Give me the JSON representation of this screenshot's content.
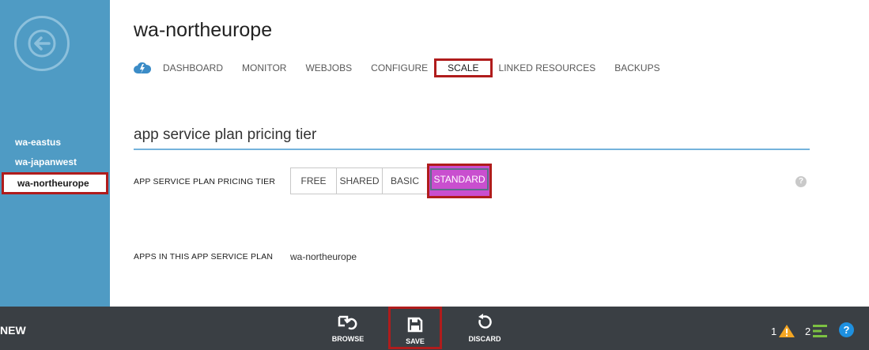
{
  "sidebar": {
    "sites": [
      {
        "label": "wa-eastus"
      },
      {
        "label": "wa-japanwest"
      },
      {
        "label": "wa-northeurope"
      }
    ]
  },
  "page": {
    "title": "wa-northeurope"
  },
  "tabs": [
    {
      "label": "DASHBOARD"
    },
    {
      "label": "MONITOR"
    },
    {
      "label": "WEBJOBS"
    },
    {
      "label": "CONFIGURE"
    },
    {
      "label": "SCALE"
    },
    {
      "label": "LINKED RESOURCES"
    },
    {
      "label": "BACKUPS"
    }
  ],
  "section": {
    "title": "app service plan pricing tier"
  },
  "pricing": {
    "label": "APP SERVICE PLAN PRICING TIER",
    "options": [
      "FREE",
      "SHARED",
      "BASIC",
      "STANDARD"
    ],
    "selected": "STANDARD"
  },
  "help": {
    "small": "?",
    "big": "?"
  },
  "apps": {
    "label": "APPS IN THIS APP SERVICE PLAN",
    "value": "wa-northeurope"
  },
  "bottombar": {
    "new_label": "NEW",
    "commands": [
      {
        "label": "BROWSE",
        "icon": "browse-icon"
      },
      {
        "label": "SAVE",
        "icon": "save-icon"
      },
      {
        "label": "DISCARD",
        "icon": "discard-icon"
      }
    ],
    "warnings_count": "1",
    "activity_count": "2"
  },
  "colors": {
    "sidebar": "#4f9bc4",
    "highlight": "#b01c1c",
    "standard_selected": "#c94fcf",
    "bottombar": "#3a3f44",
    "underline": "#74b3dc"
  }
}
